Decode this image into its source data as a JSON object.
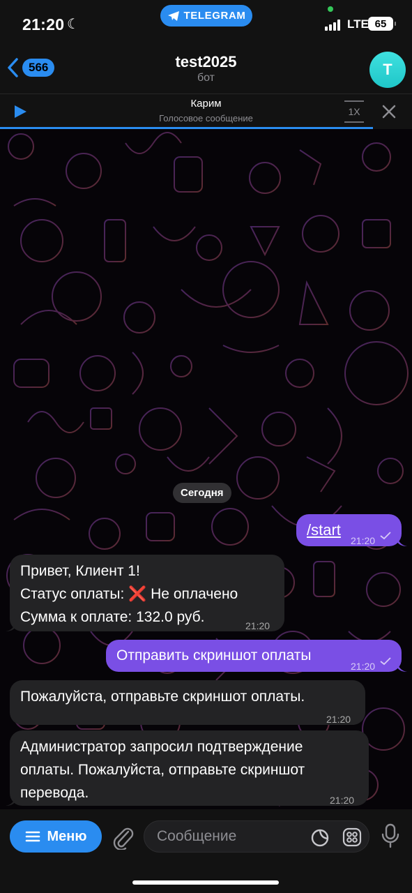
{
  "status_bar": {
    "time": "21:20",
    "app_badge": "TELEGRAM",
    "network": "LTE",
    "battery": "65"
  },
  "header": {
    "back_count": "566",
    "title": "test2025",
    "subtitle": "бот",
    "avatar_letter": "T"
  },
  "player": {
    "name": "Карим",
    "subtitle": "Голосовое сообщение",
    "speed": "1X"
  },
  "chat": {
    "date_label": "Сегодня",
    "messages": [
      {
        "direction": "out",
        "lines": [
          "/start"
        ],
        "time": "21:20",
        "is_command": true
      },
      {
        "direction": "in",
        "lines": [
          "Привет, Клиент 1!",
          "Статус оплаты:",
          "❌",
          "Не оплачено",
          "Сумма к оплате: 132.0 руб."
        ],
        "time": "21:20"
      },
      {
        "direction": "out",
        "lines": [
          "Отправить скриншот оплаты"
        ],
        "time": "21:20"
      },
      {
        "direction": "in",
        "lines": [
          "Пожалуйста, отправьте скриншот оплаты."
        ],
        "time": "21:20"
      },
      {
        "direction": "in",
        "lines": [
          "Администратор запросил подтверждение",
          "оплаты. Пожалуйста, отправьте скриншот",
          "перевода."
        ],
        "time": "21:20"
      }
    ]
  },
  "input": {
    "menu_label": "Меню",
    "placeholder": "Сообщение"
  },
  "colors": {
    "accent": "#2a8cf0",
    "outgoing_bubble": "#7a4fe5",
    "incoming_bubble": "#232325",
    "avatar": "#2ed3d4"
  }
}
